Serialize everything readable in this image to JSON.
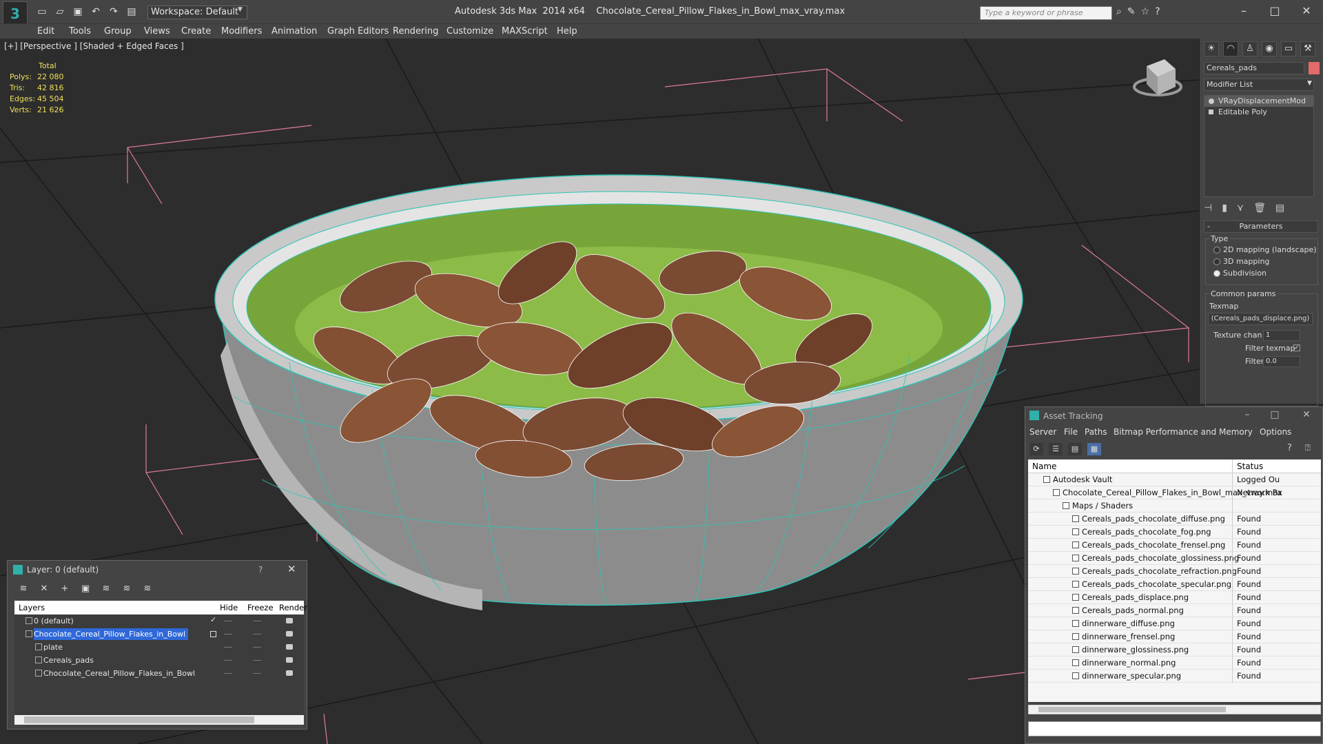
{
  "titlebar": {
    "workspace": "Workspace: Default",
    "app_title": "Autodesk 3ds Max  2014 x64",
    "file_title": "Chocolate_Cereal_Pillow_Flakes_in_Bowl_max_vray.max",
    "search_placeholder": "Type a keyword or phrase"
  },
  "menu": [
    "Edit",
    "Tools",
    "Group",
    "Views",
    "Create",
    "Modifiers",
    "Animation",
    "Graph Editors",
    "Rendering",
    "Customize",
    "MAXScript",
    "Help"
  ],
  "viewport": {
    "label": "[+] [Perspective ] [Shaded + Edged Faces ]",
    "stats": {
      "header": "Total",
      "rows": [
        {
          "k": "Polys:",
          "v": "22 080"
        },
        {
          "k": "Tris:",
          "v": "42 816"
        },
        {
          "k": "Edges:",
          "v": "45 504"
        },
        {
          "k": "Verts:",
          "v": "21 626"
        }
      ]
    }
  },
  "command_panel": {
    "object_name": "Cereals_pads",
    "object_color": "#e36b6b",
    "modifier_list": "Modifier List",
    "stack": [
      "VRayDisplacementMod",
      "Editable Poly"
    ],
    "rollout": "Parameters",
    "type_label": "Type",
    "types": [
      "2D mapping (landscape)",
      "3D mapping",
      "Subdivision"
    ],
    "selected_type": "Subdivision",
    "common_params": "Common params",
    "texmap_label": "Texmap",
    "texmap_value": "(Cereals_pads_displace.png)",
    "texture_chan_label": "Texture chan",
    "texture_chan_value": "1",
    "filter_texmap_label": "Filter texmap",
    "filter_blur_label": "Filter blur",
    "filter_blur_value": "0.0"
  },
  "asset_tracking": {
    "title": "Asset Tracking",
    "menu": [
      "Server",
      "File",
      "Paths",
      "Bitmap Performance and Memory",
      "Options"
    ],
    "columns": [
      "Name",
      "Status"
    ],
    "rows": [
      {
        "name": "Autodesk Vault",
        "status": "Logged Ou",
        "indent": 1
      },
      {
        "name": "Chocolate_Cereal_Pillow_Flakes_in_Bowl_max_vray.max",
        "status": "Network Pa",
        "indent": 2
      },
      {
        "name": "Maps / Shaders",
        "status": "",
        "indent": 3
      },
      {
        "name": "Cereals_pads_chocolate_diffuse.png",
        "status": "Found",
        "indent": 4
      },
      {
        "name": "Cereals_pads_chocolate_fog.png",
        "status": "Found",
        "indent": 4
      },
      {
        "name": "Cereals_pads_chocolate_frensel.png",
        "status": "Found",
        "indent": 4
      },
      {
        "name": "Cereals_pads_chocolate_glossiness.png",
        "status": "Found",
        "indent": 4
      },
      {
        "name": "Cereals_pads_chocolate_refraction.png",
        "status": "Found",
        "indent": 4
      },
      {
        "name": "Cereals_pads_chocolate_specular.png",
        "status": "Found",
        "indent": 4
      },
      {
        "name": "Cereals_pads_displace.png",
        "status": "Found",
        "indent": 4
      },
      {
        "name": "Cereals_pads_normal.png",
        "status": "Found",
        "indent": 4
      },
      {
        "name": "dinnerware_diffuse.png",
        "status": "Found",
        "indent": 4
      },
      {
        "name": "dinnerware_frensel.png",
        "status": "Found",
        "indent": 4
      },
      {
        "name": "dinnerware_glossiness.png",
        "status": "Found",
        "indent": 4
      },
      {
        "name": "dinnerware_normal.png",
        "status": "Found",
        "indent": 4
      },
      {
        "name": "dinnerware_specular.png",
        "status": "Found",
        "indent": 4
      }
    ]
  },
  "layer_dialog": {
    "title": "Layer: 0 (default)",
    "help": "?",
    "columns": [
      "Layers",
      "Hide",
      "Freeze",
      "Render"
    ],
    "rows": [
      {
        "name": "0 (default)",
        "indent": 1,
        "selected": false
      },
      {
        "name": "Chocolate_Cereal_Pillow_Flakes_in_Bowl",
        "indent": 1,
        "selected": true
      },
      {
        "name": "plate",
        "indent": 2,
        "selected": false
      },
      {
        "name": "Cereals_pads",
        "indent": 2,
        "selected": false
      },
      {
        "name": "Chocolate_Cereal_Pillow_Flakes_in_Bowl",
        "indent": 2,
        "selected": false
      }
    ]
  }
}
